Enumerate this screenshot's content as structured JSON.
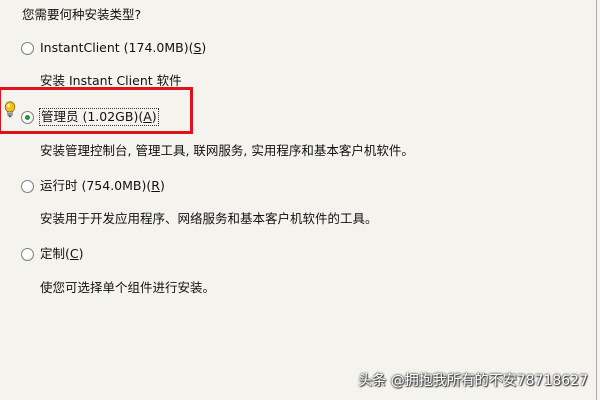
{
  "question": "您需要何种安装类型?",
  "options": [
    {
      "label": "InstantClient (174.0MB)(",
      "mnemonic": "S",
      "close": ")",
      "selected": false,
      "description": "安装 Instant Client 软件"
    },
    {
      "label": "管理员 (1.02GB)(",
      "mnemonic": "A",
      "close": ")",
      "selected": true,
      "description": "安装管理控制台, 管理工具, 联网服务, 实用程序和基本客户机软件。"
    },
    {
      "label": "运行时 (754.0MB)(",
      "mnemonic": "R",
      "close": ")",
      "selected": false,
      "description": "安装用于开发应用程序、网络服务和基本客户机软件的工具。"
    },
    {
      "label": "定制(",
      "mnemonic": "C",
      "close": ")",
      "selected": false,
      "description": "使您可选择单个组件进行安装。"
    }
  ],
  "hint_icon": "lightbulb-icon",
  "colors": {
    "highlight": "#e0101c",
    "radio_dot": "#1e9a2e",
    "background": "#f4f3ee"
  },
  "watermark": "头条 @拥抱我所有的不安78718627"
}
